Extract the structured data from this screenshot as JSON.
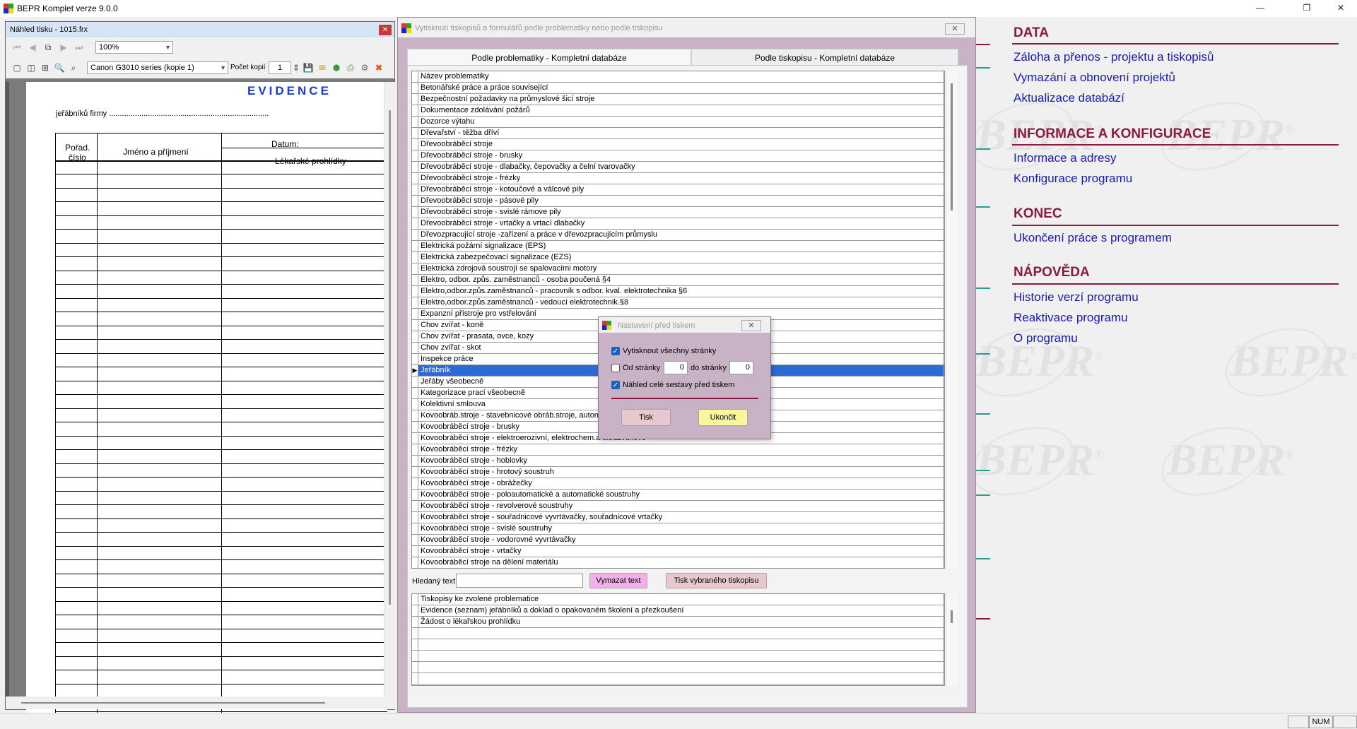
{
  "app": {
    "title": "BEPR Komplet verze 9.0.0",
    "minimize": "—",
    "restore": "❐",
    "close": "✕"
  },
  "right_menu": {
    "watermark": "BEPR",
    "watermark_mark": "®",
    "sections": [
      {
        "heading": "DATA",
        "items": [
          "Záloha a přenos - projektu a tiskopisů",
          "Vymazání a obnovení projektů",
          "Aktualizace databází"
        ]
      },
      {
        "heading": "INFORMACE A KONFIGURACE",
        "items": [
          "Informace a adresy",
          "Konfigurace programu"
        ]
      },
      {
        "heading": "KONEC",
        "items": [
          "Ukončení práce s programem"
        ]
      },
      {
        "heading": "NÁPOVĚDA",
        "items": [
          "Historie verzí programu",
          "Reaktivace programu",
          "O programu"
        ]
      }
    ]
  },
  "form": {
    "title": "Vytisknutí tiskopisů a formulářů podle problematiky nebo podle tiskopisu",
    "close": "✕",
    "tabs": [
      "Podle problematiky - Kompletní databáze",
      "Podle tiskopisu - Kompletní databáze"
    ],
    "grid_header": "Název problematiky",
    "rows": [
      "Betonářské práce a práce související",
      "Bezpečnostní požadavky na průmyslové šicí stroje",
      "Dokumentace zdolávání požárů",
      "Dozorce výtahu",
      "Dřevařství - těžba dříví",
      "Dřevoobráběcí stroje",
      "Dřevoobráběcí stroje - brusky",
      "Dřevoobráběcí stroje - dlabačky, čepovačky a čelní tvarovačky",
      "Dřevoobráběcí stroje - frézky",
      "Dřevoobráběcí stroje - kotoučové a válcové pily",
      "Dřevoobráběcí stroje - pásové pily",
      "Dřevoobráběcí stroje - svislé rámove pily",
      "Dřevoobráběcí stroje - vrtačky a vrtací dlabačky",
      "Dřevozpracující stroje -zařízení a práce v dřevozpracujícím průmyslu",
      "Elektrická požární signalizace (EPS)",
      "Elektrická zabezpečovací signalizace (EZS)",
      "Elektrická zdrojová soustrojí se spalovacími motory",
      "Elektro, odbor. způs. zaměstnanců - osoba poučená §4",
      "Elektro,odbor.způs.zaměstnanců - pracovník s odbor. kval. elektrotechnika §6",
      "Elektro,odbor.způs.zaměstnanců - vedoucí elektrotechnik.§8",
      "Expanzní přístroje pro vstřelování",
      "Chov zvířat - koně",
      "Chov zvířat - prasata, ovce, kozy",
      "Chov zvířat - skot",
      "Inspekce práce",
      "Jeřábník",
      "Jeřáby všeobecně",
      "Kategorizace prací všeobecně",
      "Kolektivní smlouva",
      "Kovoobráb.stroje - stavebnicové obráb.stroje, automa",
      "Kovoobráběcí stroje - brusky",
      "Kovoobráběcí stroje - elektroerozivní, elektrochem.a ultrazvukové",
      "Kovoobráběcí stroje - frézky",
      "Kovoobráběcí stroje - hoblovky",
      "Kovoobráběcí stroje - hrotový soustruh",
      "Kovoobráběcí stroje - obrážečky",
      "Kovoobráběcí stroje - poloautomatické a automatické soustruhy",
      "Kovoobráběcí stroje - revolverové soustruhy",
      "Kovoobráběcí stroje - souřadnicové vyvrtávačky, souřadnicové vrtačky",
      "Kovoobráběcí stroje - svislé soustruhy",
      "Kovoobráběcí stroje - vodorovné vyvrtávačky",
      "Kovoobráběcí stroje - vrtačky",
      "Kovoobráběcí stroje na dělení materiálu"
    ],
    "selected_index": 25,
    "row_pointer": "▶",
    "search_label": "Hledaný text",
    "search_value": "",
    "clear_button": "Vymazat text",
    "print_selected_button": "Tisk vybraného tiskopisu",
    "forms_header": "Tiskopisy ke zvolené problematice",
    "forms": [
      "Evidence (seznam) jeřábníků a doklad o opakovaném školení a přezkoušení",
      "Žádost o lékařskou prohlídku"
    ]
  },
  "preview": {
    "title": "Náhled tisku - 1015.frx",
    "close": "✕",
    "zoom": "100%",
    "printer": "Canon G3010 series (kopie 1)",
    "copies_label": "Počet kopií",
    "copies": "1",
    "doc": {
      "heading": "EVIDENCE",
      "subtitle": "jeřábníků firmy ..........................................................................",
      "col_order_1": "Pořad.",
      "col_order_2": "číslo",
      "col_name": "Jméno a příjmení",
      "col_date": "Datum:",
      "col_medical": "Lékařské prohlídky"
    }
  },
  "dialog": {
    "title": "Nastavení před tiskem",
    "close": "✕",
    "print_all": "Vytisknout všechny stránky",
    "print_all_checked": true,
    "from_page": "Od stránky",
    "from_value": "0",
    "to_page": "do stránky",
    "to_value": "0",
    "preview_full": "Náhled celé sestavy před tiskem",
    "preview_full_checked": true,
    "print_button": "Tisk",
    "close_button": "Ukončit"
  },
  "status": {
    "num": "NUM"
  },
  "colors": {
    "heading": "#8b1a3d",
    "link": "#1a1ab0",
    "selection": "#2a6bd6",
    "teal_tick": "#2a9d8f",
    "maroon_tick": "#8b1a3d"
  }
}
